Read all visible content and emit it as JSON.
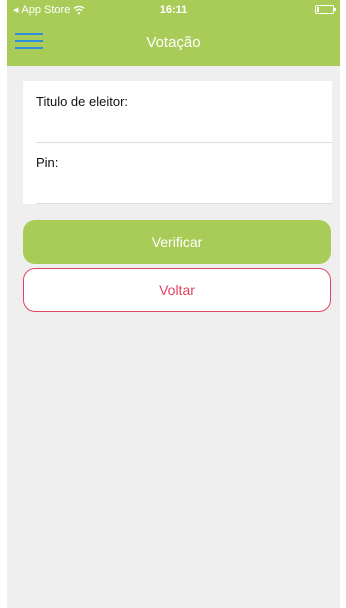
{
  "status_bar": {
    "back_label": "App Store",
    "time": "16:11"
  },
  "header": {
    "title": "Votação"
  },
  "form": {
    "voter_id_label": "Titulo de eleitor:",
    "voter_id_value": "",
    "pin_label": "Pin:",
    "pin_value": ""
  },
  "actions": {
    "verify_label": "Verificar",
    "back_label": "Voltar"
  },
  "colors": {
    "primary": "#a9cc58",
    "danger": "#e0445f",
    "menu_icon": "#2d8fd9",
    "background": "#efefef"
  },
  "icons": {
    "status_back": "back-triangle-icon",
    "wifi": "wifi-icon",
    "battery": "battery-icon",
    "menu": "hamburger-menu-icon"
  }
}
